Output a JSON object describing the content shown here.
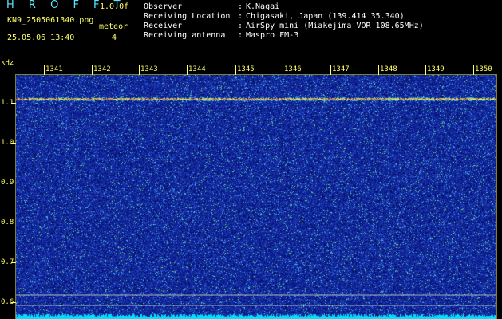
{
  "app": {
    "title": "H R O F F T",
    "version": "1.0.0f"
  },
  "file": {
    "name": "KN9_2505061340.png",
    "datetime": "25.05.06 13:40"
  },
  "mode": {
    "label": "meteor",
    "value": "4"
  },
  "metadata": [
    {
      "label": "Observer",
      "value": "K.Nagai"
    },
    {
      "label": "Receiving Location",
      "value": "Chigasaki, Japan (139.414 35.340)"
    },
    {
      "label": "Receiver",
      "value": "AirSpy mini (Miakejima VOR 108.65MHz)"
    },
    {
      "label": "Receiving antenna",
      "value": "Maspro FM-3"
    }
  ],
  "separator": ":",
  "spectrogram": {
    "y_unit": "kHz",
    "y_ticks": [
      "1.1",
      "1.0",
      "0.9",
      "0.8",
      "0.7",
      "0.6"
    ],
    "x_ticks": [
      "1341",
      "1342",
      "1343",
      "1344",
      "1345",
      "1346",
      "1347",
      "1348",
      "1349",
      "1350"
    ],
    "colors": {
      "background": "#0a1a8c",
      "carrier": "#ff3a3a",
      "tick_color": "#ffff66",
      "reference_line": "#cccccc",
      "bottom_band": "#00e0ff"
    }
  }
}
